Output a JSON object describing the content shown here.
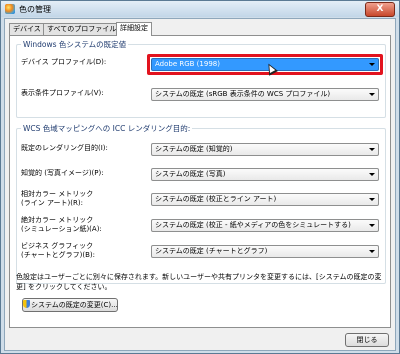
{
  "window": {
    "title": "色の管理",
    "close_label": "X"
  },
  "tabs": [
    {
      "label": "デバイス"
    },
    {
      "label": "すべてのプロファイル"
    },
    {
      "label": "詳細設定"
    }
  ],
  "windows_group": {
    "title": "Windows 色システムの既定値",
    "device_profile_label": "デバイス プロファイル(D):",
    "device_profile_value": "Adobe RGB (1998)",
    "viewing_label": "表示条件プロファイル(V):",
    "viewing_value": "システムの既定 (sRGB 表示条件の WCS プロファイル)"
  },
  "wcs_group": {
    "title": "WCS 色域マッピングへの ICC レンダリング目的:",
    "rows": [
      {
        "label": "既定のレンダリング目的(I):",
        "value": "システムの既定 (知覚的)"
      },
      {
        "label": "知覚的 (写真イメージ)(P):",
        "value": "システムの既定 (写真)"
      },
      {
        "label1": "相対カラー メトリック",
        "label2": "(ライン アート)(R):",
        "value": "システムの既定 (校正とライン アート)"
      },
      {
        "label1": "絶対カラー メトリック",
        "label2": "(シミュレーション紙)(A):",
        "value": "システムの既定 (校正 - 紙やメディアの色をシミュレートする)"
      },
      {
        "label1": "ビジネス グラフィック",
        "label2": "(チャートとグラフ)(B):",
        "value": "システムの既定 (チャートとグラフ)"
      }
    ]
  },
  "note": "色設定はユーザーごとに別々に保存されます。新しいユーザーや共有プリンタを変更するには、[システムの既定の変更] をクリックしてください。",
  "change_defaults_label": "システムの既定の変更(C)...",
  "close_button_label": "閉じる"
}
